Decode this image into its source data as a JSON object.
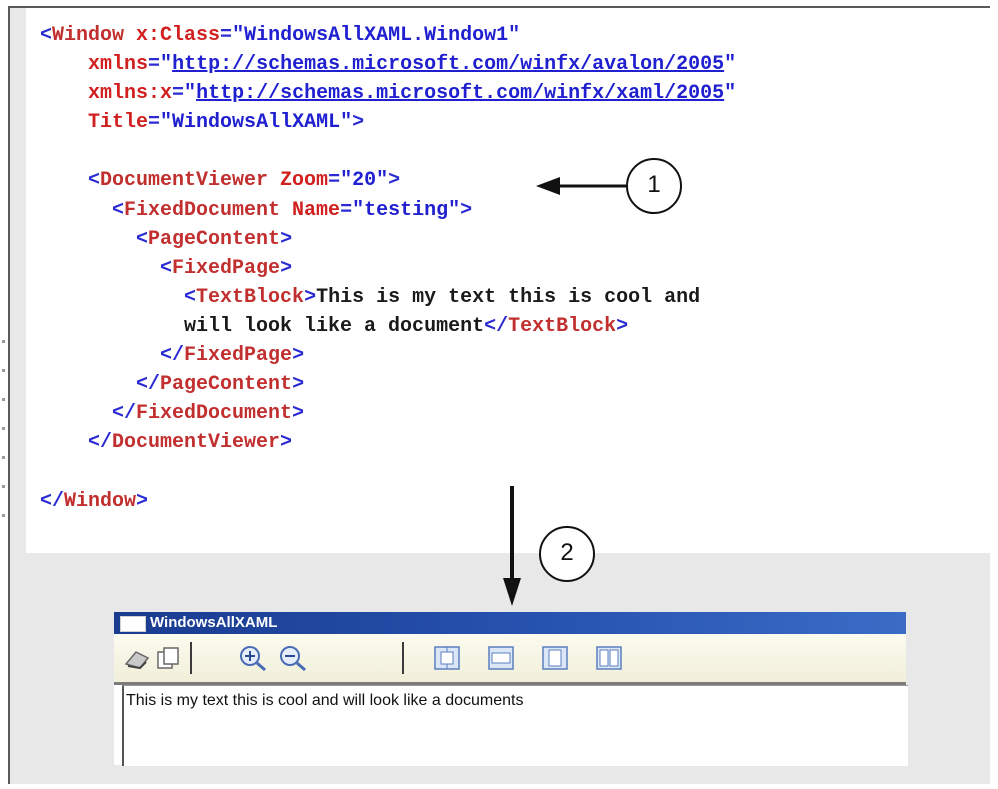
{
  "code": {
    "lines": [
      [
        {
          "t": "<",
          "c": "c-tag"
        },
        {
          "t": "Window",
          "c": "c-name"
        },
        {
          "t": " x:Class",
          "c": "c-attr"
        },
        {
          "t": "=",
          "c": "c-tag"
        },
        {
          "t": "\"WindowsAllXAML.Window1\"",
          "c": "c-val"
        }
      ],
      [
        {
          "t": "    xmlns",
          "c": "c-attr"
        },
        {
          "t": "=",
          "c": "c-tag"
        },
        {
          "t": "\"",
          "c": "c-val"
        },
        {
          "t": "http://schemas.microsoft.com/winfx/avalon/2005",
          "c": "c-link"
        },
        {
          "t": "\"",
          "c": "c-val"
        }
      ],
      [
        {
          "t": "    xmlns:x",
          "c": "c-attr"
        },
        {
          "t": "=",
          "c": "c-tag"
        },
        {
          "t": "\"",
          "c": "c-val"
        },
        {
          "t": "http://schemas.microsoft.com/winfx/xaml/2005",
          "c": "c-link"
        },
        {
          "t": "\"",
          "c": "c-val"
        }
      ],
      [
        {
          "t": "    Title",
          "c": "c-attr"
        },
        {
          "t": "=",
          "c": "c-tag"
        },
        {
          "t": "\"WindowsAllXAML\"",
          "c": "c-val"
        },
        {
          "t": ">",
          "c": "c-tag"
        }
      ],
      [
        {
          "t": "",
          "c": "c-text"
        }
      ],
      [
        {
          "t": "    <",
          "c": "c-tag"
        },
        {
          "t": "DocumentViewer",
          "c": "c-name"
        },
        {
          "t": " Zoom",
          "c": "c-attr"
        },
        {
          "t": "=",
          "c": "c-tag"
        },
        {
          "t": "\"20\"",
          "c": "c-val"
        },
        {
          "t": ">",
          "c": "c-tag"
        }
      ],
      [
        {
          "t": "      <",
          "c": "c-tag"
        },
        {
          "t": "FixedDocument",
          "c": "c-name"
        },
        {
          "t": " Name",
          "c": "c-attr"
        },
        {
          "t": "=",
          "c": "c-tag"
        },
        {
          "t": "\"testing\"",
          "c": "c-val"
        },
        {
          "t": ">",
          "c": "c-tag"
        }
      ],
      [
        {
          "t": "        <",
          "c": "c-tag"
        },
        {
          "t": "PageContent",
          "c": "c-name"
        },
        {
          "t": ">",
          "c": "c-tag"
        }
      ],
      [
        {
          "t": "          <",
          "c": "c-tag"
        },
        {
          "t": "FixedPage",
          "c": "c-name"
        },
        {
          "t": ">",
          "c": "c-tag"
        }
      ],
      [
        {
          "t": "            <",
          "c": "c-tag"
        },
        {
          "t": "TextBlock",
          "c": "c-name"
        },
        {
          "t": ">",
          "c": "c-tag"
        },
        {
          "t": "This is my text this is cool and",
          "c": "c-text"
        }
      ],
      [
        {
          "t": "            will look like a document",
          "c": "c-text"
        },
        {
          "t": "</",
          "c": "c-tag"
        },
        {
          "t": "TextBlock",
          "c": "c-name"
        },
        {
          "t": ">",
          "c": "c-tag"
        }
      ],
      [
        {
          "t": "          </",
          "c": "c-tag"
        },
        {
          "t": "FixedPage",
          "c": "c-name"
        },
        {
          "t": ">",
          "c": "c-tag"
        }
      ],
      [
        {
          "t": "        </",
          "c": "c-tag"
        },
        {
          "t": "PageContent",
          "c": "c-name"
        },
        {
          "t": ">",
          "c": "c-tag"
        }
      ],
      [
        {
          "t": "      </",
          "c": "c-tag"
        },
        {
          "t": "FixedDocument",
          "c": "c-name"
        },
        {
          "t": ">",
          "c": "c-tag"
        }
      ],
      [
        {
          "t": "    </",
          "c": "c-tag"
        },
        {
          "t": "DocumentViewer",
          "c": "c-name"
        },
        {
          "t": ">",
          "c": "c-tag"
        }
      ],
      [
        {
          "t": "",
          "c": "c-text"
        }
      ],
      [
        {
          "t": "</",
          "c": "c-tag"
        },
        {
          "t": "Window",
          "c": "c-name"
        },
        {
          "t": ">",
          "c": "c-tag"
        }
      ]
    ]
  },
  "annotations": {
    "callout_1": "1",
    "callout_2": "2"
  },
  "window": {
    "title": "WindowsAllXAML",
    "toolbar": [
      {
        "name": "print-icon"
      },
      {
        "name": "copy-icon"
      },
      {
        "name": "zoom-in-icon"
      },
      {
        "name": "zoom-out-icon"
      },
      {
        "name": "actual-size-icon"
      },
      {
        "name": "page-width-icon"
      },
      {
        "name": "whole-page-icon"
      },
      {
        "name": "two-pages-icon"
      }
    ],
    "document_text": "This is my text this is cool and will look like a documents"
  },
  "colors": {
    "tag": "#2b2bd4",
    "element_name": "#c22f2f",
    "attribute": "#d12020",
    "value": "#2020d0",
    "titlebar": "#1a3b8f",
    "toolbar_bg": "#f1efd9"
  }
}
